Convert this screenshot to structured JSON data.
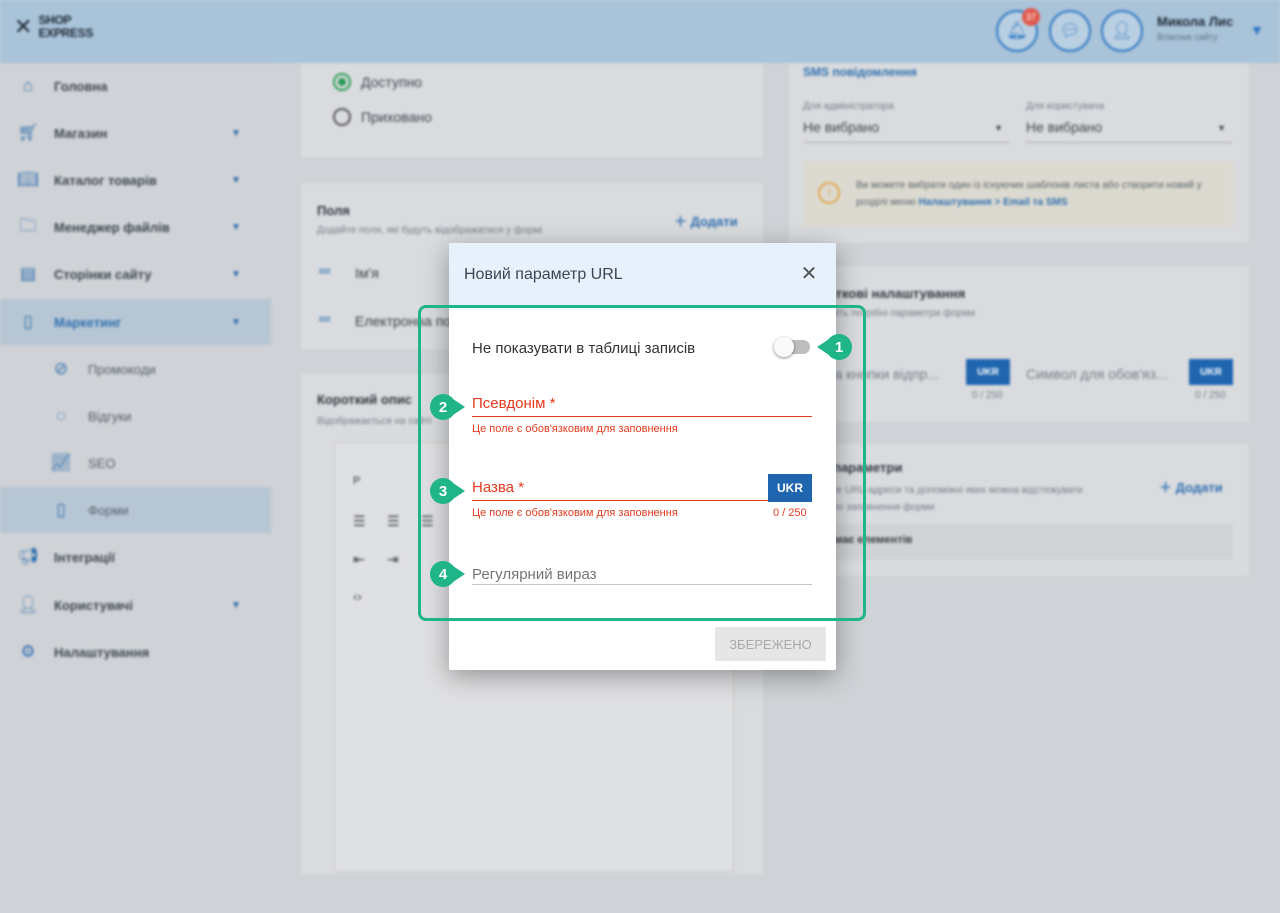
{
  "header": {
    "logo_text": "SHOP\nEXPRESS",
    "notification_count": "37",
    "user_name": "Микола Лис",
    "user_subtitle": "Власник сайту"
  },
  "sidebar": {
    "items": [
      {
        "label": "Головна",
        "icon": "home-icon"
      },
      {
        "label": "Магазин",
        "icon": "cart-icon",
        "has_chevron": true
      },
      {
        "label": "Каталог товарів",
        "icon": "book-icon",
        "has_chevron": true
      },
      {
        "label": "Менеджер файлів",
        "icon": "folder-icon",
        "has_chevron": true
      },
      {
        "label": "Сторінки сайту",
        "icon": "pages-icon",
        "has_chevron": true
      },
      {
        "label": "Маркетинг",
        "icon": "marketing-icon",
        "has_chevron": true,
        "active": true
      },
      {
        "label": "Промокоди",
        "icon": "promo-icon",
        "sub": true
      },
      {
        "label": "Відгуки",
        "icon": "reviews-icon",
        "sub": true
      },
      {
        "label": "SEO",
        "icon": "seo-icon",
        "sub": true
      },
      {
        "label": "Форми",
        "icon": "forms-icon",
        "sub": true,
        "active": true
      },
      {
        "label": "Інтеграції",
        "icon": "integrations-icon"
      },
      {
        "label": "Користувачі",
        "icon": "users-icon",
        "has_chevron": true
      },
      {
        "label": "Налаштування",
        "icon": "settings-icon"
      }
    ]
  },
  "background": {
    "visibility_options": [
      "Доступно",
      "Приховано"
    ],
    "fields_card": {
      "title": "Поля",
      "subtitle": "Додайте поля, які будуть відображатися у формі",
      "add_label": "Додати",
      "rows": [
        "Ім'я",
        "Електронна пошта"
      ]
    },
    "short_desc": {
      "title": "Короткий опис",
      "subtitle": "Відображається на сайті",
      "format_label": "P"
    },
    "sms": {
      "title": "SMS повідомлення",
      "admin_label": "Для адміністратора",
      "admin_value": "Не вибрано",
      "user_label": "Для користувача",
      "user_value": "Не вибрано",
      "info": "Ви можете вибрати один із існуючих шаблонів листа або створити новий у розділі меню",
      "info_link": "Налаштування > Email та SMS"
    },
    "extra": {
      "title": "Додаткові налаштування",
      "subtitle": "Заповніть потрібні параметри форми",
      "input1": "Назва кнопки відпр...",
      "input2": "Символ для обов'яз...",
      "ukr": "UKR",
      "count1": "0 / 250",
      "count2": "0 / 250"
    },
    "url_params": {
      "title": "URL параметри",
      "subtitle": "Додайте URL-адреси та допоміжні яких можна відстежувати джерело заповнення форми",
      "add_label": "Додати",
      "empty": "Не має елементів"
    }
  },
  "modal": {
    "title": "Новий параметр URL",
    "toggle_label": "Не показувати в таблиці записів",
    "alias_label": "Псевдонім *",
    "alias_error": "Це поле є обов'язковим для заповнення",
    "name_label": "Назва *",
    "name_error": "Це поле є обов'язковим для заповнення",
    "name_counter": "0 / 250",
    "lang_button": "UKR",
    "regex_placeholder": "Регулярний вираз",
    "save_label": "ЗБЕРЕЖЕНО"
  },
  "markers": [
    "1",
    "2",
    "3",
    "4"
  ],
  "colors": {
    "accent": "#1fb588",
    "error": "#e53b1e",
    "primary": "#1f65b0",
    "header_bg": "#e6f1fb"
  }
}
